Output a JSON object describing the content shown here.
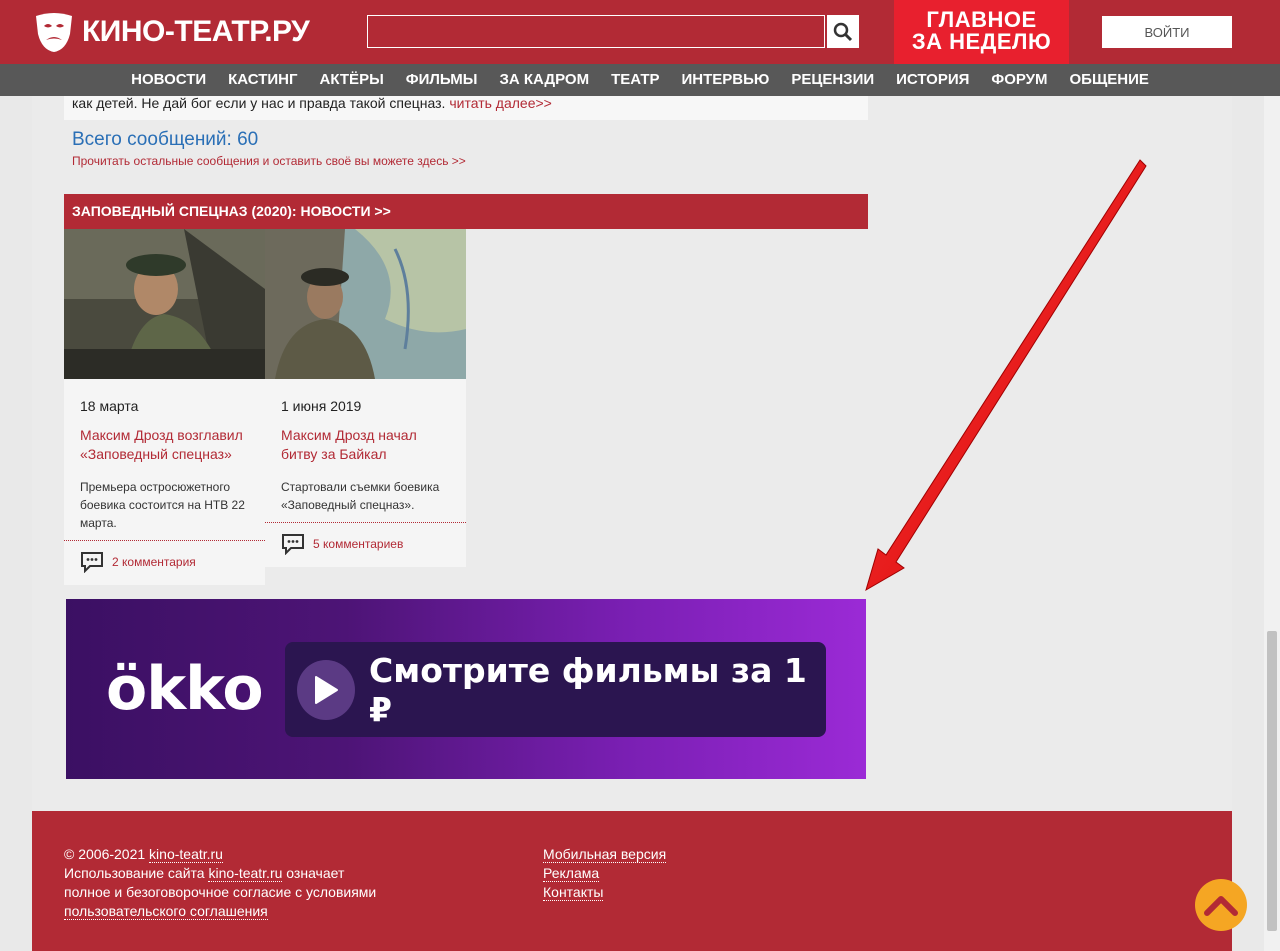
{
  "header": {
    "logo_text": "КИНО-ТЕАТР.РУ",
    "search_placeholder": "",
    "promo_line1": "ГЛАВНОЕ",
    "promo_line2": "ЗА НЕДЕЛЮ",
    "login_label": "ВОЙТИ"
  },
  "nav": [
    "НОВОСТИ",
    "КАСТИНГ",
    "АКТЁРЫ",
    "ФИЛЬМЫ",
    "ЗА КАДРОМ",
    "ТЕАТР",
    "ИНТЕРВЬЮ",
    "РЕЦЕНЗИИ",
    "ИСТОРИЯ",
    "ФОРУМ",
    "ОБЩЕНИЕ"
  ],
  "messages": {
    "tail_text": "как детей. Не дай бог если у нас и правда такой спецназ. ",
    "read_more": "читать далее>>",
    "total": "Всего сообщений: 60",
    "read_rest": "Прочитать остальные сообщения и оставить своё вы можете здесь >>"
  },
  "news": {
    "heading": "ЗАПОВЕДНЫЙ СПЕЦНАЗ (2020): НОВОСТИ >>",
    "items": [
      {
        "date": "18 марта",
        "title": "Максим Дрозд возглавил «Заповедный спецназ»",
        "lead": "Премьера остросюжетного боевика состоится на НТВ 22 марта.",
        "comments": "2 комментария"
      },
      {
        "date": "1 июня 2019",
        "title": "Максим Дрозд начал битву за Байкал",
        "lead": "Стартовали съемки боевика «Заповедный спецназ».",
        "comments": "5 комментариев"
      }
    ]
  },
  "ad": {
    "logo": "ökko",
    "text": "Смотрите фильмы за 1 ₽"
  },
  "footer": {
    "copyright_prefix": "© 2006-2021 ",
    "site": "kino-teatr.ru",
    "usage_prefix": "Использование сайта ",
    "usage_site": "kino-teatr.ru",
    "usage_suffix": " означает полное и безоговорочное согласие с условиями ",
    "agreement": "пользовательского соглашения",
    "links": [
      "Мобильная версия",
      "Реклама",
      "Контакты"
    ]
  },
  "colors": {
    "brand": "#b22a35",
    "nav_bg": "#585858",
    "promo": "#e8202e",
    "accent_link": "#2a6fb6",
    "totop": "#f5a623"
  }
}
